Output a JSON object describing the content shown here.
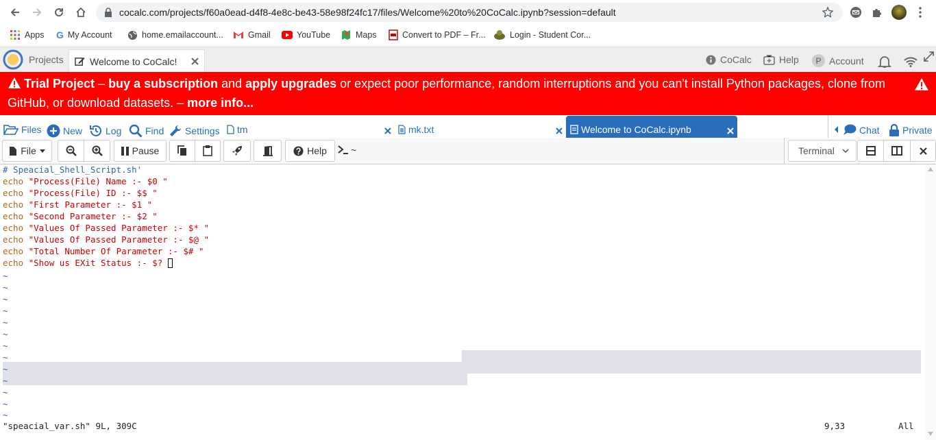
{
  "browser": {
    "url": "cocalc.com/projects/f60a0ead-d4f8-4e8c-be43-58e98f24fc17/files/Welcome%20to%20CoCalc.ipynb?session=default",
    "bookmarks": [
      "Apps",
      "My Account",
      "home.emailaccount...",
      "Gmail",
      "YouTube",
      "Maps",
      "Convert to PDF – Fr...",
      "Login - Student Cor..."
    ]
  },
  "cocalc_top": {
    "projects_label": "Projects",
    "file_tab_label": "Welcome to CoCalc!",
    "cocalc_label": "CoCalc",
    "help_label": "Help",
    "account_label": "Account",
    "account_initial": "P"
  },
  "banner": {
    "trial": "Trial Project",
    "dash1": " – ",
    "buy": "buy a subscription",
    "and": " and ",
    "apply": "apply upgrades",
    "rest": " or expect poor performance, random interruptions and you can't install Python packages, clone from GitHub, or download datasets. – ",
    "more": "more info..."
  },
  "project_tabs": {
    "files": "Files",
    "new": "New",
    "log": "Log",
    "find": "Find",
    "settings": "Settings",
    "tab_tm": "tm",
    "tab_mk": "mk.txt",
    "tab_welcome": "Welcome to CoCalc.ipynb",
    "chat": "Chat",
    "private": "Private"
  },
  "toolbar": {
    "file": "File",
    "pause": "Pause",
    "help": "Help",
    "prompt": "~",
    "terminal_select": "Terminal"
  },
  "terminal": {
    "lines": [
      {
        "kw": "",
        "str": "",
        "cmt": "# Speacial_Shell_Script.sh'"
      },
      {
        "kw": "echo",
        "str": " \"Process(File) Name :- $0 \"",
        "cmt": ""
      },
      {
        "kw": "echo",
        "str": " \"Process(File) ID :- $$ \"",
        "cmt": ""
      },
      {
        "kw": "echo",
        "str": " \"First Parameter :- $1 \"",
        "cmt": ""
      },
      {
        "kw": "echo",
        "str": " \"Second Parameter :- $2 \"",
        "cmt": ""
      },
      {
        "kw": "echo",
        "str": " \"Values Of Passed Parameter :- $* \"",
        "cmt": ""
      },
      {
        "kw": "echo",
        "str": " \"Values Of Passed Parameter :- $@ \"",
        "cmt": ""
      },
      {
        "kw": "echo",
        "str": " \"Total Number Of Parameter :- $# \"",
        "cmt": ""
      },
      {
        "kw": "echo",
        "str": " \"Show us EXit Status :- $? ",
        "cmt": ""
      }
    ],
    "tilde": "~",
    "status_file": "\"speacial_var.sh\" 9L, 309C",
    "status_pos": "9,33",
    "status_all": "All"
  },
  "colors": {
    "banner_bg": "#ff0000",
    "accent": "#2a6ebb",
    "keyword": "#b5651d",
    "string": "#cc0000",
    "comment": "#3465a4"
  }
}
